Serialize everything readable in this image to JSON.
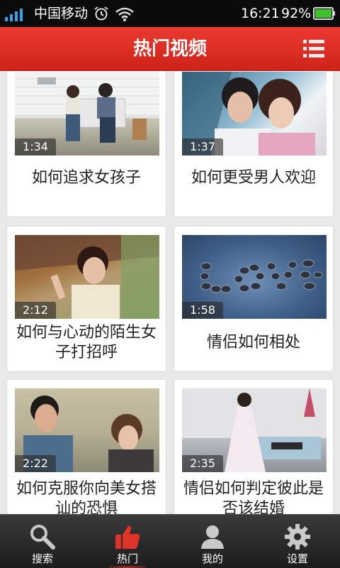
{
  "status_bar": {
    "carrier": "中国移动",
    "time": "16:21",
    "battery_percent": "92%",
    "icons": [
      "signal-icon",
      "alarm-icon",
      "wifi-icon",
      "battery-icon"
    ]
  },
  "header": {
    "title": "热门视频",
    "menu_icon": "list-menu-icon"
  },
  "videos": [
    {
      "duration": "1:34",
      "title": "如何追求女孩子"
    },
    {
      "duration": "1:37",
      "title": "如何更受男人欢迎"
    },
    {
      "duration": "2:12",
      "title": "如何与心动的陌生女子打招呼"
    },
    {
      "duration": "1:58",
      "title": "情侣如何相处"
    },
    {
      "duration": "2:22",
      "title": "如何克服你向美女搭讪的恐惧"
    },
    {
      "duration": "2:35",
      "title": "情侣如何判定彼此是否该结婚"
    }
  ],
  "tabs": [
    {
      "label": "搜索",
      "icon": "search-icon"
    },
    {
      "label": "热门",
      "icon": "thumbs-up-icon",
      "active": true
    },
    {
      "label": "我的",
      "icon": "user-icon"
    },
    {
      "label": "设置",
      "icon": "gear-icon"
    }
  ],
  "colors": {
    "header_red": "#d9291f",
    "tab_active_red": "#e03327",
    "battery_green": "#3fc22c"
  }
}
